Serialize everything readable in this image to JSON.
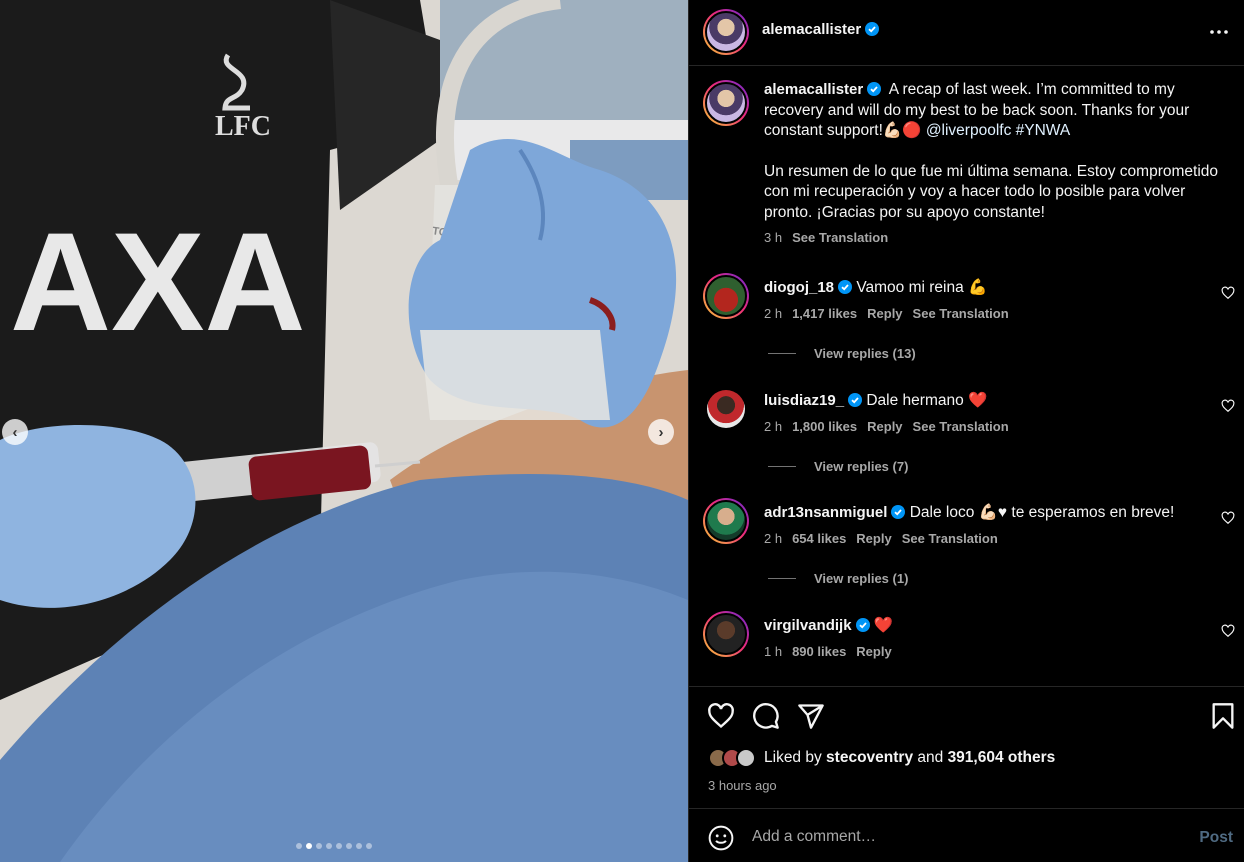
{
  "post": {
    "author": "alemacallister",
    "caption_en": "A recap of last week. I’m committed to my recovery and will do my best to be back soon. Thanks for your constant support!💪🏻🔴 ",
    "caption_mention": "@liverpoolfc",
    "caption_tag": "#YNWA",
    "caption_es": "Un resumen de lo que fue mi última semana. Estoy comprometido con mi recuperación y voy a hacer todo lo posible para volver pronto. ¡Gracias por su apoyo constante!",
    "caption_time": "3 h",
    "see_translation": "See Translation",
    "media_brand_text": "AXA",
    "media_club_text": "LFC",
    "probe_brand_text": "TOSHIBA",
    "carousel": {
      "count": 8,
      "active_index": 1
    }
  },
  "comments": [
    {
      "username": "diogoj_18",
      "text": "Vamoo mi reina 💪",
      "time": "2 h",
      "likes": "1,417 likes",
      "reply": "Reply",
      "translate": "See Translation",
      "replies": "View replies (13)",
      "ring": true
    },
    {
      "username": "luisdiaz19_",
      "text": "Dale hermano ❤️",
      "time": "2 h",
      "likes": "1,800 likes",
      "reply": "Reply",
      "translate": "See Translation",
      "replies": "View replies (7)",
      "ring": false
    },
    {
      "username": "adr13nsanmiguel",
      "text": "Dale loco 💪🏻♥ te esperamos en breve!",
      "time": "2 h",
      "likes": "654 likes",
      "reply": "Reply",
      "translate": "See Translation",
      "replies": "View replies (1)",
      "ring": true
    },
    {
      "username": "virgilvandijk",
      "text": "❤️",
      "time": "1 h",
      "likes": "890 likes",
      "reply": "Reply",
      "ring": true
    }
  ],
  "likes_summary": {
    "prefix": "Liked by",
    "user": "stecoventry",
    "middle": "and",
    "others": "391,604 others"
  },
  "posted_ago": "3 hours ago",
  "add_comment": {
    "placeholder": "Add a comment…",
    "post_label": "Post"
  },
  "colors": {
    "verified": "#0095f6",
    "secondary_text": "#a8a8a8",
    "divider": "#262626",
    "post_disabled": "#4f6a82"
  },
  "icons": [
    "more-icon",
    "verified-icon",
    "heart-icon",
    "comment-icon",
    "share-icon",
    "bookmark-icon",
    "emoji-icon",
    "chevron-left-icon",
    "chevron-right-icon"
  ]
}
